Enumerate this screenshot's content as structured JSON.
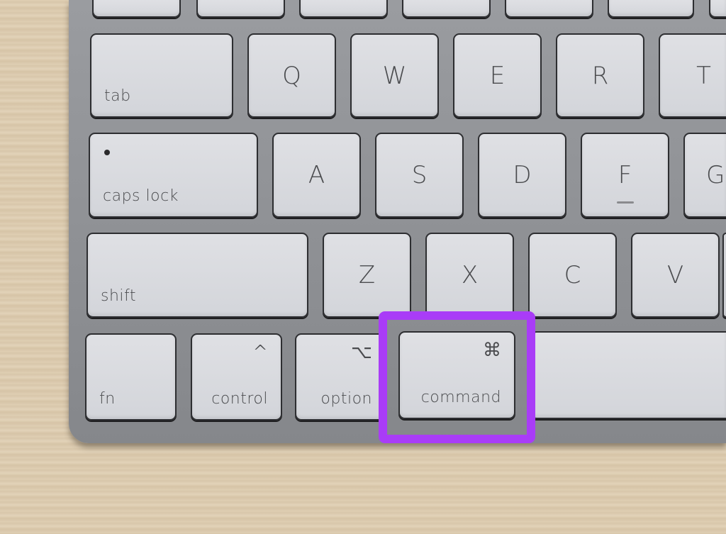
{
  "keyboard": {
    "row1": {
      "tab": "tab",
      "q": "Q",
      "w": "W",
      "e": "E",
      "r": "R",
      "t": "T"
    },
    "row2": {
      "caps_lock": "caps lock",
      "a": "A",
      "s": "S",
      "d": "D",
      "f": "F",
      "g": "G"
    },
    "row3": {
      "shift": "shift",
      "z": "Z",
      "x": "X",
      "c": "C",
      "v": "V"
    },
    "row4": {
      "fn": "fn",
      "control": "control",
      "control_symbol": "^",
      "option": "option",
      "option_symbol": "⌥",
      "command": "command",
      "command_symbol": "⌘"
    }
  },
  "highlight": {
    "target": "command",
    "color": "#a93cf7"
  }
}
